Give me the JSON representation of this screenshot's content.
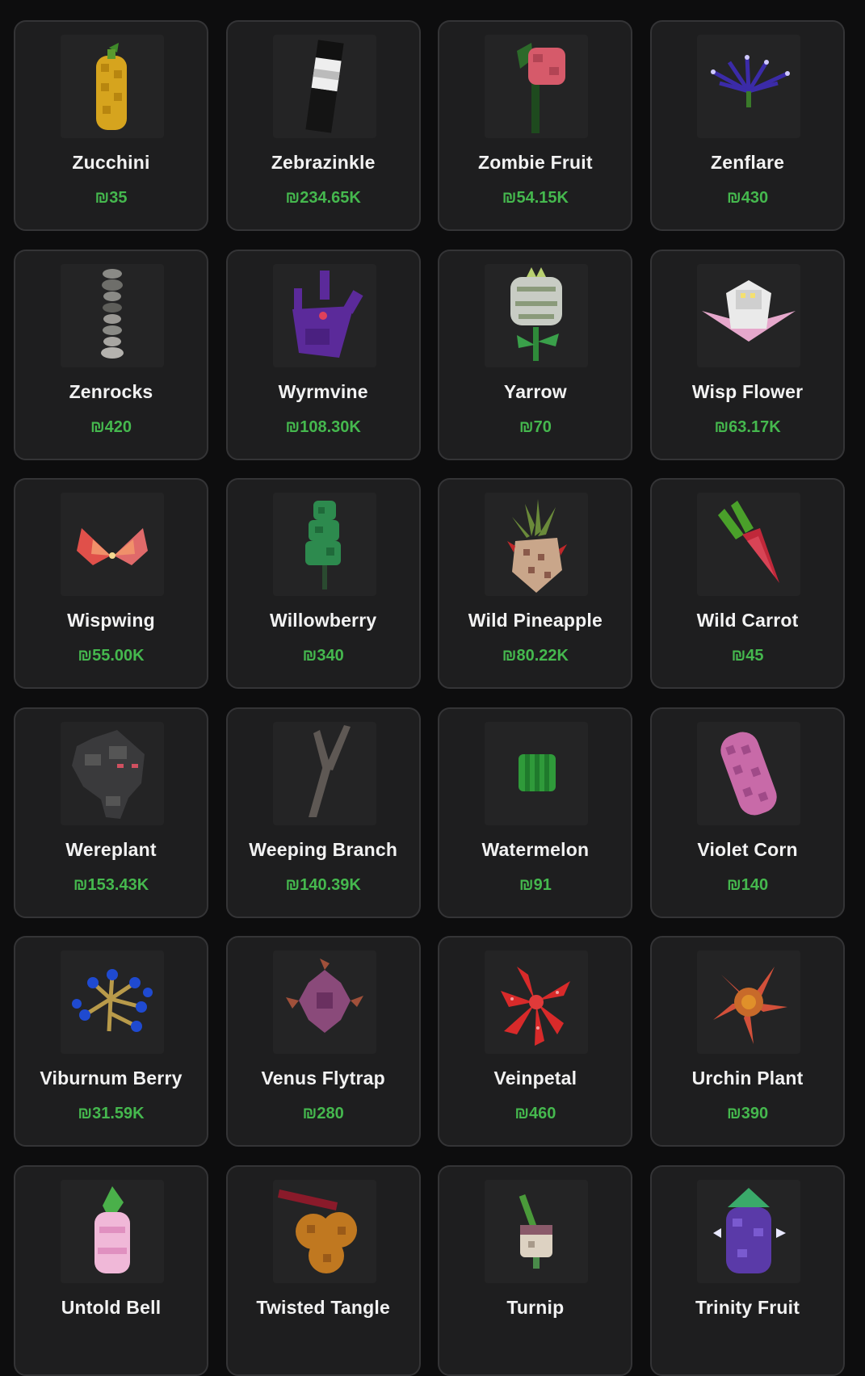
{
  "items": [
    {
      "name": "Zucchini",
      "price": "₪35",
      "icon": "zucchini-icon"
    },
    {
      "name": "Zebrazinkle",
      "price": "₪234.65K",
      "icon": "zebrazinkle-icon"
    },
    {
      "name": "Zombie Fruit",
      "price": "₪54.15K",
      "icon": "zombie-fruit-icon"
    },
    {
      "name": "Zenflare",
      "price": "₪430",
      "icon": "zenflare-icon"
    },
    {
      "name": "Zenrocks",
      "price": "₪420",
      "icon": "zenrocks-icon"
    },
    {
      "name": "Wyrmvine",
      "price": "₪108.30K",
      "icon": "wyrmvine-icon"
    },
    {
      "name": "Yarrow",
      "price": "₪70",
      "icon": "yarrow-icon"
    },
    {
      "name": "Wisp Flower",
      "price": "₪63.17K",
      "icon": "wisp-flower-icon"
    },
    {
      "name": "Wispwing",
      "price": "₪55.00K",
      "icon": "wispwing-icon"
    },
    {
      "name": "Willowberry",
      "price": "₪340",
      "icon": "willowberry-icon"
    },
    {
      "name": "Wild Pineapple",
      "price": "₪80.22K",
      "icon": "wild-pineapple-icon"
    },
    {
      "name": "Wild Carrot",
      "price": "₪45",
      "icon": "wild-carrot-icon"
    },
    {
      "name": "Wereplant",
      "price": "₪153.43K",
      "icon": "wereplant-icon"
    },
    {
      "name": "Weeping Branch",
      "price": "₪140.39K",
      "icon": "weeping-branch-icon"
    },
    {
      "name": "Watermelon",
      "price": "₪91",
      "icon": "watermelon-icon"
    },
    {
      "name": "Violet Corn",
      "price": "₪140",
      "icon": "violet-corn-icon"
    },
    {
      "name": "Viburnum Berry",
      "price": "₪31.59K",
      "icon": "viburnum-berry-icon"
    },
    {
      "name": "Venus Flytrap",
      "price": "₪280",
      "icon": "venus-flytrap-icon"
    },
    {
      "name": "Veinpetal",
      "price": "₪460",
      "icon": "veinpetal-icon"
    },
    {
      "name": "Urchin Plant",
      "price": "₪390",
      "icon": "urchin-plant-icon"
    },
    {
      "name": "Untold Bell",
      "price": "",
      "icon": "untold-bell-icon"
    },
    {
      "name": "Twisted Tangle",
      "price": "",
      "icon": "twisted-tangle-icon"
    },
    {
      "name": "Turnip",
      "price": "",
      "icon": "turnip-icon"
    },
    {
      "name": "Trinity Fruit",
      "price": "",
      "icon": "trinity-fruit-icon"
    }
  ]
}
